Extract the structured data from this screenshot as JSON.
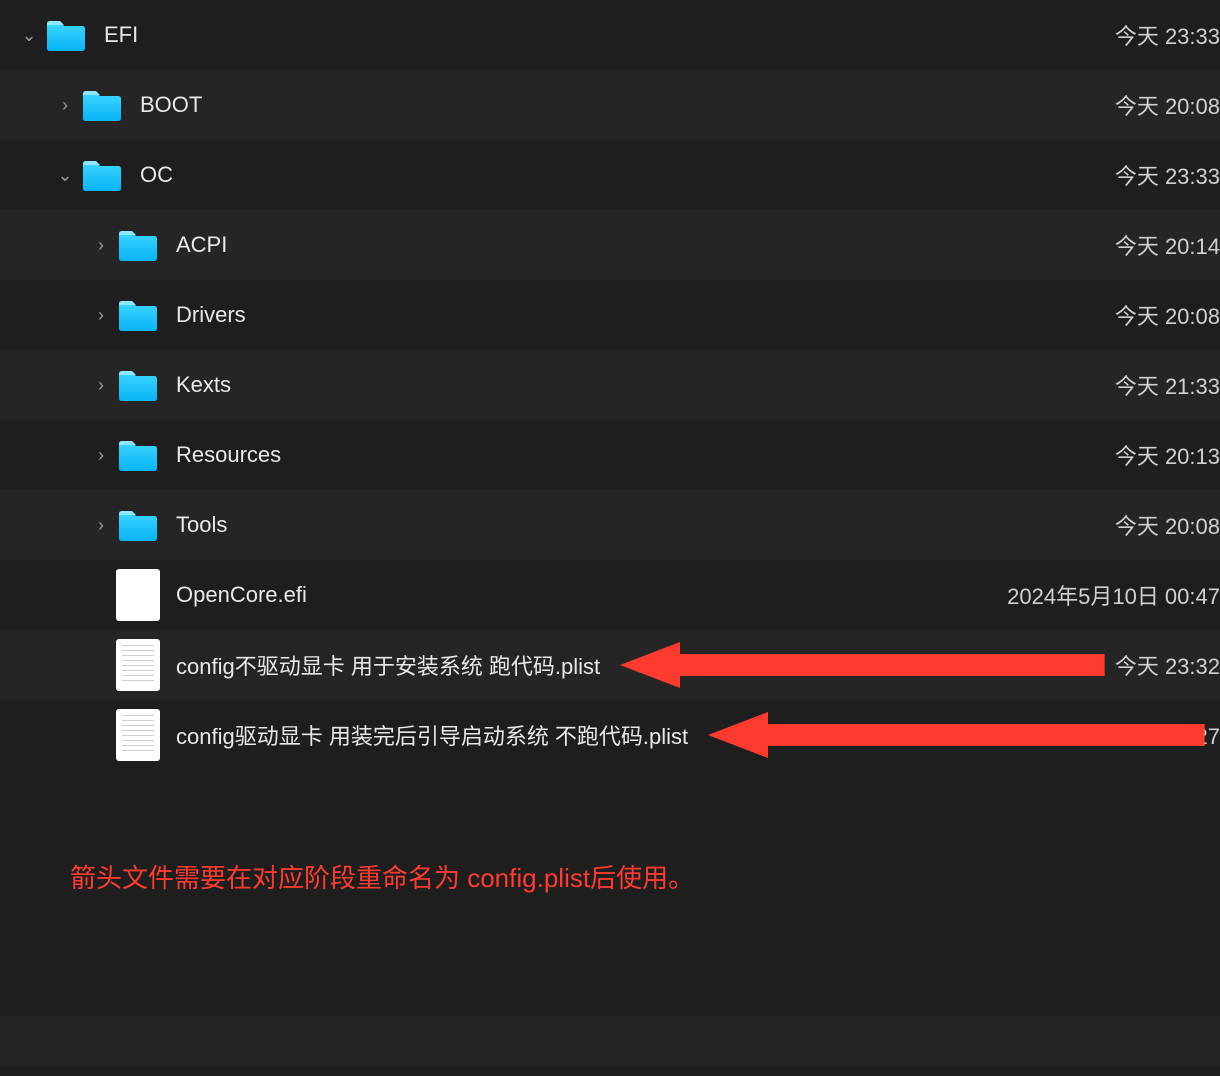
{
  "rows": [
    {
      "indent": 0,
      "chev": "down",
      "icon": "folder",
      "name": "EFI",
      "date": "今天 23:33",
      "alt": false
    },
    {
      "indent": 1,
      "chev": "right",
      "icon": "folder",
      "name": "BOOT",
      "date": "今天 20:08",
      "alt": true
    },
    {
      "indent": 1,
      "chev": "down",
      "icon": "folder",
      "name": "OC",
      "date": "今天 23:33",
      "alt": false
    },
    {
      "indent": 2,
      "chev": "right",
      "icon": "folder",
      "name": "ACPI",
      "date": "今天 20:14",
      "alt": true
    },
    {
      "indent": 2,
      "chev": "right",
      "icon": "folder",
      "name": "Drivers",
      "date": "今天 20:08",
      "alt": false
    },
    {
      "indent": 2,
      "chev": "right",
      "icon": "folder",
      "name": "Kexts",
      "date": "今天 21:33",
      "alt": true
    },
    {
      "indent": 2,
      "chev": "right",
      "icon": "folder",
      "name": "Resources",
      "date": "今天 20:13",
      "alt": false
    },
    {
      "indent": 2,
      "chev": "right",
      "icon": "folder",
      "name": "Tools",
      "date": "今天 20:08",
      "alt": true
    },
    {
      "indent": 2,
      "chev": "",
      "icon": "file-blank",
      "name": "OpenCore.efi",
      "date": "2024年5月10日 00:47",
      "alt": false
    },
    {
      "indent": 2,
      "chev": "",
      "icon": "file-plist",
      "name": "config不驱动显卡 用于安装系统 跑代码.plist",
      "date": "今天 23:32",
      "alt": true,
      "arrow": true
    },
    {
      "indent": 2,
      "chev": "",
      "icon": "file-plist",
      "name": "config驱动显卡 用装完后引导启动系统 不跑代码.plist",
      "date": "今天 23:27",
      "alt": false,
      "arrow": true
    }
  ],
  "caption": "箭头文件需要在对应阶段重命名为 config.plist后使用。",
  "colors": {
    "accent_arrow": "#ff3b2f",
    "folder": "#1ec8ff"
  }
}
